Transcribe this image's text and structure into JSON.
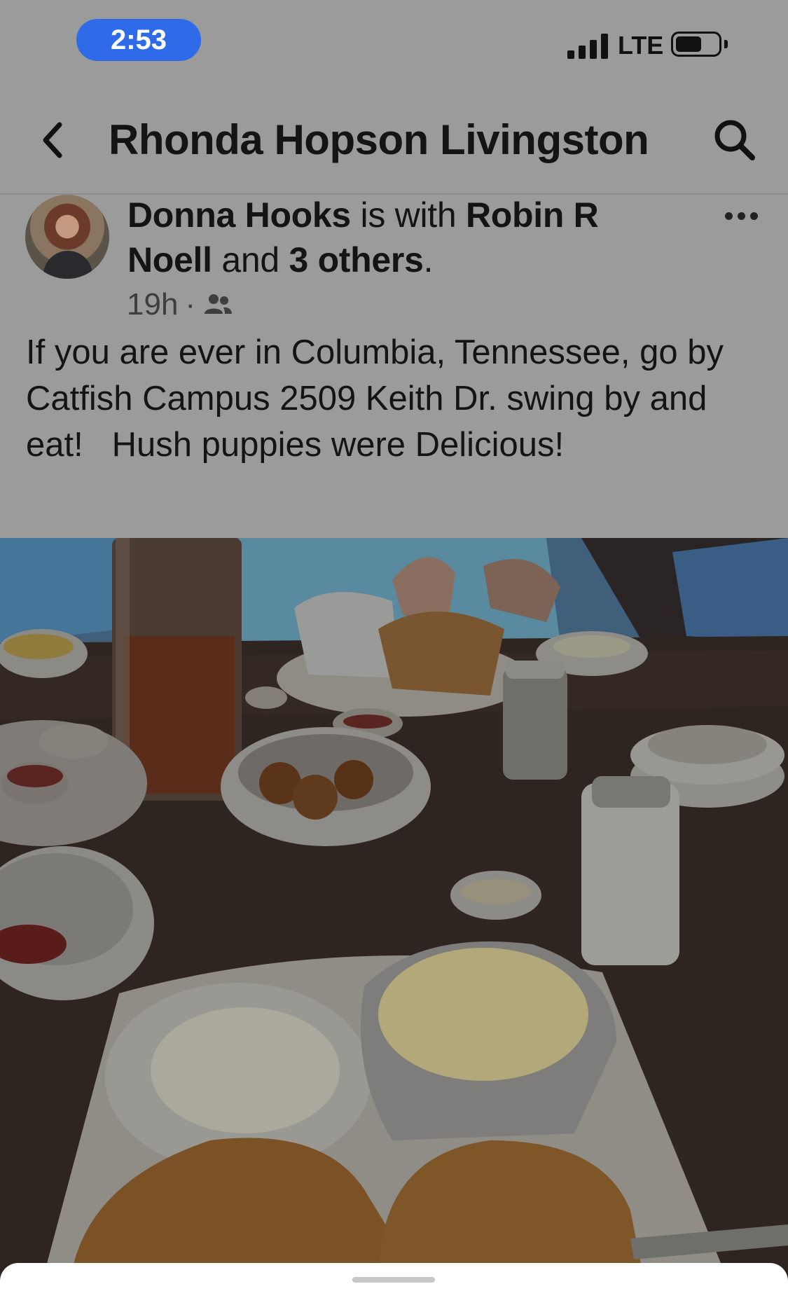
{
  "status_bar": {
    "time": "2:53",
    "network": "LTE",
    "accent_color": "#2f6be8",
    "icons": [
      "signal-icon",
      "battery-icon"
    ]
  },
  "header": {
    "title": "Rhonda Hopson Livingston",
    "icons": [
      "back-chevron-icon",
      "search-icon"
    ]
  },
  "post": {
    "author": "Donna Hooks",
    "with_text": " is with ",
    "tagged": "Robin R Noell",
    "and_text": " and ",
    "others": "3 others",
    "period": ".",
    "time_ago": "19h",
    "separator": "·",
    "audience_icon": "friends-icon",
    "text": "If you are ever in Columbia, Tennessee, go by Catfish Campus 2509 Keith Dr. swing by and eat!   Hush puppies were Delicious!"
  }
}
